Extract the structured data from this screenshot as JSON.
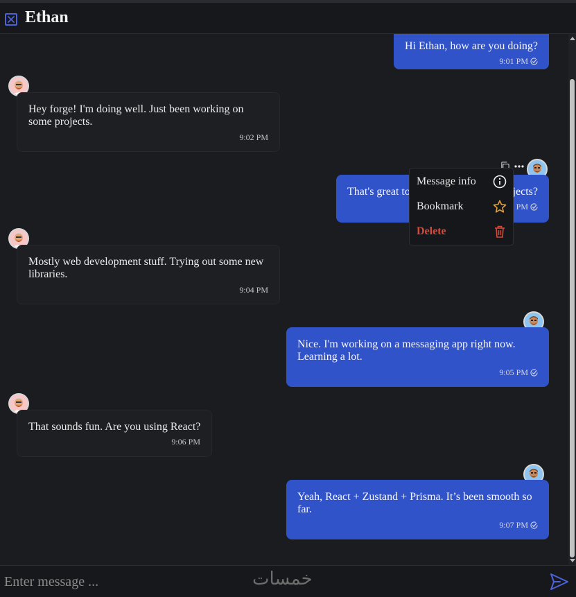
{
  "header": {
    "title": "Ethan",
    "close_icon": "close-icon"
  },
  "messages": [
    {
      "direction": "out",
      "text": "Hi Ethan, how are you doing?",
      "time": "9:01 PM"
    },
    {
      "direction": "in",
      "text": "Hey forge! I'm doing well. Just been working on some projects.",
      "time": "9:02 PM"
    },
    {
      "direction": "out",
      "text": "That's great to hear! What kind of projects?",
      "text_visible": "That's great to",
      "text_visible_end": "jects?",
      "time_visible": "PM"
    },
    {
      "direction": "in",
      "text": "Mostly web development stuff. Trying out some new libraries.",
      "time": "9:04 PM"
    },
    {
      "direction": "out",
      "text": "Nice. I'm working on a messaging app right now. Learning a lot.",
      "time": "9:05 PM"
    },
    {
      "direction": "in",
      "text": "That sounds fun. Are you using React?",
      "time": "9:06 PM"
    },
    {
      "direction": "out",
      "text": "Yeah, React + Zustand + Prisma. It’s been smooth so far.",
      "time": "9:07 PM"
    }
  ],
  "context_menu": {
    "items": [
      {
        "label": "Message info",
        "icon": "info-icon"
      },
      {
        "label": "Bookmark",
        "icon": "star-icon"
      },
      {
        "label": "Delete",
        "icon": "trash-icon"
      }
    ]
  },
  "composer": {
    "placeholder": "Enter message ...",
    "send_icon": "send-icon"
  },
  "watermark": "خمسات",
  "colors": {
    "background": "#1a1c20",
    "outgoing_bubble": "#3153c9",
    "incoming_bubble": "#1d1f23",
    "accent": "#4c63d9",
    "delete": "#d64a3a",
    "star": "#e8a23a"
  }
}
